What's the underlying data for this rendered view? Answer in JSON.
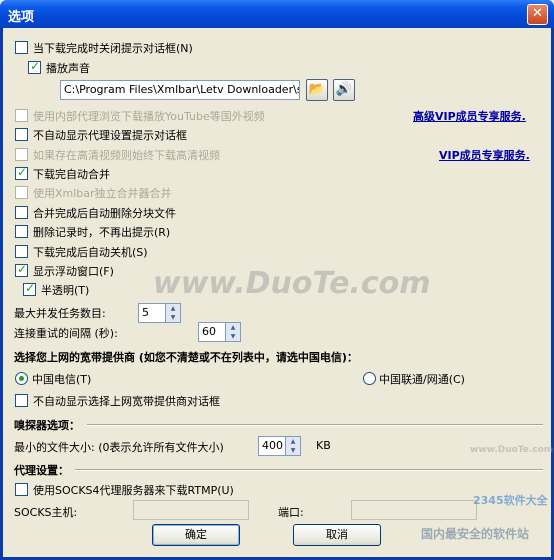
{
  "window": {
    "title": "选项",
    "close_glyph": "✕"
  },
  "options": {
    "close_prompt": "当下载完成时关闭提示对话框(N)",
    "play_sound": "播放声音",
    "sound_path": "C:\\Program Files\\Xmlbar\\Letv Downloader\\sound:",
    "use_internal_proxy": "使用内部代理浏览下载播放YouTube等国外视频",
    "vip_link_1": "高级VIP成员专享服务.",
    "no_proxy_prompt": "不自动显示代理设置提示对话框",
    "prefer_hd": "如果存在高清视频则始终下载高清视频",
    "vip_link_2": "VIP成员专享服务.",
    "auto_merge": "下载完自动合并",
    "use_xmlbar_merger": "使用Xmlbar独立合并器合并",
    "delete_parts": "合并完成后自动删除分块文件",
    "no_delete_prompt": "删除记录时，不再出提示(R)",
    "auto_shutdown": "下载完成后自动关机(S)",
    "show_float_window": "显示浮动窗口(F)",
    "semi_transparent": "半透明(T)",
    "max_tasks_label": "最大并发任务数目:",
    "max_tasks_value": "5",
    "retry_interval_label": "连接重试的间隔 (秒):",
    "retry_interval_value": "60"
  },
  "isp": {
    "heading": "选择您上网的宽带提供商 (如您不清楚或不在列表中，请选中国电信)：",
    "telecom": "中国电信(T)",
    "unicom": "中国联通/网通(C)",
    "no_isp_prompt": "不自动显示选择上网宽带提供商对话框"
  },
  "sniffer": {
    "heading": "嗅探器选项：",
    "min_size_label": "最小的文件大小: (0表示允许所有文件大小)",
    "min_size_value": "400",
    "unit": "KB"
  },
  "proxy": {
    "heading": "代理设置：",
    "use_socks4": "使用SOCKS4代理服务器来下载RTMP(U)",
    "host_label": "SOCKS主机:",
    "port_label": "端口:"
  },
  "buttons": {
    "ok": "确定",
    "cancel": "取消"
  },
  "watermarks": {
    "duote": "www.DuoTe.com",
    "duote_small": "www.DuoTe.com",
    "brand": "2345软件大全",
    "brand_slogan": "国内最安全的软件站"
  },
  "icons": {
    "browse": "folder-open-icon",
    "play": "speaker-icon"
  }
}
